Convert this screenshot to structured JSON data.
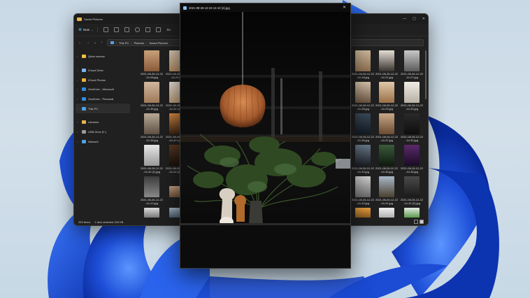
{
  "colors": {
    "accent": "#4cc2ff",
    "explorer_bg": "#202020",
    "bloom_dark": "#0a2a9a",
    "bloom_light": "#3d7bff"
  },
  "explorer": {
    "title": "Saved Pictures",
    "toolbar": {
      "new_label": "New",
      "sort_label": "So"
    },
    "address": {
      "segments": [
        "This PC",
        "Pictures",
        "Saved Pictures"
      ]
    },
    "nav": [
      {
        "label": "Quick access",
        "icon": "star-icon"
      },
      {
        "label": "iCloud Drive",
        "icon": "cloud-icon"
      },
      {
        "label": "iCloud Photos",
        "icon": "photos-icon"
      },
      {
        "label": "OneDrive - Microsoft",
        "icon": "onedrive-icon"
      },
      {
        "label": "OneDrive - Personal",
        "icon": "onedrive-icon"
      },
      {
        "label": "This PC",
        "icon": "computer-icon"
      },
      {
        "label": "Libraries",
        "icon": "library-icon"
      },
      {
        "label": "USB Drive (F:)",
        "icon": "usb-drive-icon"
      },
      {
        "label": "Network",
        "icon": "network-icon"
      }
    ],
    "files_left": [
      {
        "label": "2021-08-26-12-22\n-14-08.jpg"
      },
      {
        "label": "2021-08-26-12-22\n-14-29.jpg"
      },
      {
        "label": "2021-08-26-12-22\n-14-35.jpg"
      },
      {
        "label": "2021-08-26-12-22\n-14-32 (2).jpg"
      },
      {
        "label": "2021-08-26-12-22\n-14-38.jpg"
      },
      {
        "label": "2021-08-26-12-22\n-14-40 (1).jpg"
      },
      {
        "label": "2021-08-26-12-22\n-14-40 (2).jpg"
      },
      {
        "label": "2021-08-26-12-22\n-14-42 (2).jpg"
      },
      {
        "label": "2021-08-26-12-22\n-14-12.jpg"
      },
      {
        "label": ""
      },
      {
        "label": ""
      },
      {
        "label": ""
      }
    ],
    "files_right": [
      {
        "label": "2021-08-26-12-22\n-14-18.jpg"
      },
      {
        "label": "2021-08-26-12-22\n-14-21.jpg"
      },
      {
        "label": "2021-08-26-12-22\n-14-27.jpg"
      },
      {
        "label": "2021-08-26-12-22\n-14-28.jpg"
      },
      {
        "label": "2021-08-26-12-22\n-14-29.jpg"
      },
      {
        "label": "2021-08-26-12-22\n-14-30.jpg"
      },
      {
        "label": "2021-08-26-12-22\n-14-36.jpg"
      },
      {
        "label": "2021-08-26-12-22\n-14-37.jpg"
      },
      {
        "label": "2021-08-26-12-22\n-14-32.jpg"
      },
      {
        "label": "2021-08-26-12-22\n-14-40.jpg"
      },
      {
        "label": "2021-08-26-12-22\n-14-36.jpg"
      },
      {
        "label": "2021-08-26-12-22\n-14-38.jpg"
      },
      {
        "label": "2021-08-26-12-22\n-14-42.jpg"
      },
      {
        "label": "2021-08-26-12-22\n-14-41.jpg"
      },
      {
        "label": "2021-08-26-12-22\n-14-42 (2).jpg"
      },
      {
        "label": "2021-08-26-12-22\n-14-41.jpg"
      },
      {
        "label": "2021-08-26-12-22\n-14-45.jpg"
      },
      {
        "label": "2021-08-26-12-22\n-14-46.jpg"
      },
      {
        "label": ""
      },
      {
        "label": ""
      },
      {
        "label": ""
      }
    ],
    "status": {
      "items": "253 items",
      "selected": "1 item selected 320 KB"
    }
  },
  "viewer": {
    "title": "2021-08-26-12-22-14-10 (2).jpg"
  }
}
